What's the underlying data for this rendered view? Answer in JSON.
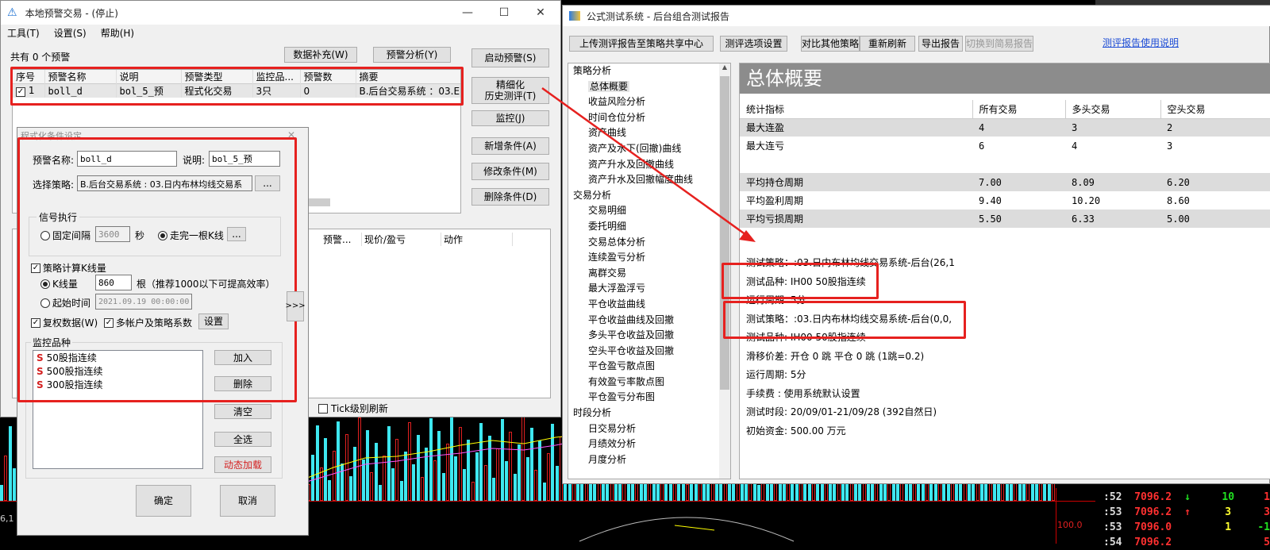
{
  "local_alert": {
    "title": "本地预警交易 - (停止)",
    "menu": [
      "工具(T)",
      "设置(S)",
      "帮助(H)"
    ],
    "count_text": "共有 0 个预警",
    "btn_data_fill": "数据补充(W)",
    "btn_alert_analysis": "预警分析(Y)",
    "btn_start": "启动预警(S)",
    "btn_fine_line1": "精细化",
    "btn_fine_line2": "历史测评(T)",
    "btn_monitor": "监控(J)",
    "btn_add_cond": "新增条件(A)",
    "btn_modify_cond": "修改条件(M)",
    "btn_delete_cond": "删除条件(D)",
    "columns": [
      "序号",
      "预警名称",
      "说明",
      "预警类型",
      "监控品...",
      "预警数",
      "摘要"
    ],
    "row": {
      "index": "1",
      "name": "boll_d",
      "desc": "bol_5_预",
      "type": "程式化交易",
      "products": "3只",
      "count": "0",
      "summary": "B.后台交易系统 ：03.E"
    },
    "lower_columns": [
      "预警...",
      "现价/盈亏",
      "动作"
    ],
    "tick_refresh": "Tick级别刷新"
  },
  "cond_dialog": {
    "title": "程式化条件设定",
    "name_label": "预警名称:",
    "name_value": "boll_d",
    "desc_label": "说明:",
    "desc_value": "bol_5_预",
    "strategy_label": "选择策略:",
    "strategy_value": "B.后台交易系统 : 03.日内布林均线交易系",
    "ellipsis": "...",
    "signal_group": "信号执行",
    "fixed_interval": "固定间隔",
    "interval_value": "3600",
    "seconds": "秒",
    "after_bar": "走完一根K线",
    "calc_k": "策略计算K线量",
    "k_count_label": "K线量",
    "k_count_value": "860",
    "k_hint": "根（推荐1000以下可提高效率）",
    "start_time_label": "起始时间",
    "start_time_value": "2021.09.19 00:00:00",
    "restore_rights": "复权数据(W)",
    "multi_account": "多帐户及策略系数",
    "settings_btn": "设置",
    "monitor_group": "监控品种",
    "products": [
      "50股指连续",
      "500股指连续",
      "300股指连续"
    ],
    "btn_add": "加入",
    "btn_delete": "删除",
    "btn_clear": "清空",
    "btn_select_all": "全选",
    "btn_dynamic": "动态加载",
    "btn_ok": "确定",
    "btn_cancel": "取消",
    "expand": ">>>"
  },
  "report": {
    "title": "公式测试系统 - 后台组合测试报告",
    "toolbar": [
      "上传测评报告至策略共享中心",
      "测评选项设置",
      "对比其他策略",
      "重新刷新",
      "导出报告",
      "切换到简易报告"
    ],
    "help_link": "测评报告使用说明",
    "tree_section_1": "策略分析",
    "tree_items_1": [
      "总体概要",
      "收益风险分析",
      "时间仓位分析",
      "资产曲线",
      "资产及水下(回撤)曲线",
      "资产升水及回撤曲线",
      "资产升水及回撤幅度曲线"
    ],
    "tree_section_2": "交易分析",
    "tree_items_2": [
      "交易明细",
      "委托明细",
      "交易总体分析",
      "连续盈亏分析",
      "离群交易",
      "最大浮盈浮亏",
      "平仓收益曲线",
      "平仓收益曲线及回撤",
      "多头平仓收益及回撤",
      "空头平仓收益及回撤",
      "平仓盈亏散点图",
      "有效盈亏率散点图",
      "平仓盈亏分布图"
    ],
    "tree_section_3": "时段分析",
    "tree_items_3": [
      "日交易分析",
      "月绩效分析",
      "月度分析"
    ],
    "heading": "总体概要",
    "stat_columns": [
      "统计指标",
      "所有交易",
      "多头交易",
      "空头交易"
    ],
    "stat_rows_a": [
      {
        "label": "最大连盈",
        "all": "4",
        "long": "3",
        "short": "2"
      },
      {
        "label": "最大连亏",
        "all": "6",
        "long": "4",
        "short": "3"
      }
    ],
    "stat_rows_b": [
      {
        "label": "平均持仓周期",
        "all": "7.00",
        "long": "8.09",
        "short": "6.20"
      },
      {
        "label": "平均盈利周期",
        "all": "9.40",
        "long": "10.20",
        "short": "8.60"
      },
      {
        "label": "平均亏损周期",
        "all": "5.50",
        "long": "6.33",
        "short": "5.00"
      }
    ],
    "info": [
      "测试策略：:03.日内布林均线交易系统-后台(26,1",
      "测试品种: IH00 50股指连续",
      "运行周期: 5分",
      "测试策略：:03.日内布林均线交易系统-后台(0,0,",
      "测试品种: IH00 50股指连续",
      "滑移价差: 开仓 0 跳 平仓 0 跳 (1跳=0.2)",
      "运行周期: 5分",
      "手续费 : 使用系统默认设置",
      "测试时段: 20/09/01-21/09/28 (392自然日)",
      "初始资金: 500.00 万元"
    ]
  },
  "ticks": [
    {
      "time": ":52",
      "price": "7096.2",
      "arrow": "↓",
      "vol": "10",
      "chg": "1"
    },
    {
      "time": ":53",
      "price": "7096.2",
      "arrow": "↑",
      "vol": "3",
      "chg": "3"
    },
    {
      "time": ":53",
      "price": "7096.0",
      "arrow": "",
      "vol": "1",
      "chg": "-1"
    },
    {
      "time": ":54",
      "price": "7096.2",
      "arrow": "",
      "vol": "",
      "chg": "5"
    }
  ],
  "chart_side": {
    "left_label": "6,1",
    "mid_value": "100.0"
  },
  "colors": {
    "highlight": "#e6211f",
    "report_heading_bg": "#8c8c8c",
    "bar_cyan": "#3ee7f0",
    "bar_red": "#e02020"
  }
}
